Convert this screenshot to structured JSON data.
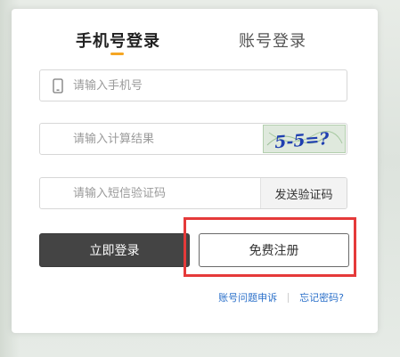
{
  "tabs": {
    "active_label": "手机号登录",
    "inactive_label": "账号登录"
  },
  "phone_field": {
    "placeholder": "请输入手机号",
    "value": ""
  },
  "captcha_field": {
    "placeholder": "请输入计算结果",
    "value": "",
    "captcha_text": "5-5=?"
  },
  "sms_field": {
    "placeholder": "请输入短信验证码",
    "value": "",
    "send_code_label": "发送验证码"
  },
  "buttons": {
    "login_label": "立即登录",
    "register_label": "免费注册"
  },
  "links": {
    "account_issue": "账号问题申诉",
    "forgot_password": "忘记密码?"
  },
  "colors": {
    "accent": "#f5a623",
    "login_button": "#444444",
    "link": "#2a6fc9",
    "highlight": "#e53a3a"
  }
}
